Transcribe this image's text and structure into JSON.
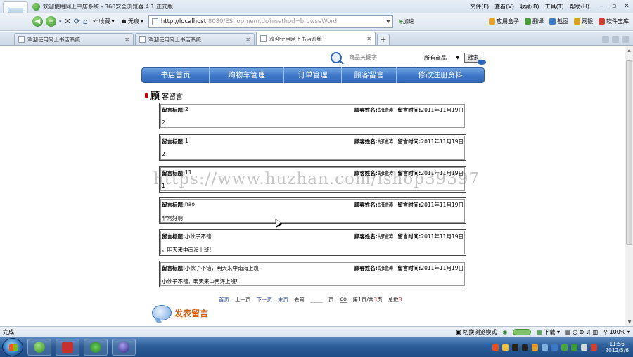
{
  "window": {
    "title": "欢迎使用网上书店系统 - 360安全浏览器 4.1 正式版",
    "menus": [
      "文件(F)",
      "查看(V)",
      "收藏(B)",
      "工具(T)",
      "帮助(H)"
    ],
    "controls": {
      "min": "–",
      "max": "▫",
      "close": "✕"
    }
  },
  "toolbar": {
    "favorites_label": "收藏",
    "no_trace_label": "无痕",
    "url_host": "http://localhost",
    "url_rest": ":8080/EShopmem.do?method=browseWord",
    "accel_label": "加速",
    "right_buttons": [
      "应用盒子",
      "翻译",
      "截图",
      "网银",
      "软件宝库"
    ]
  },
  "tabs": [
    {
      "label": "欢迎使用网上书店系统",
      "active": false
    },
    {
      "label": "欢迎使用网上书店系统",
      "active": false
    },
    {
      "label": "欢迎使用网上书店系统",
      "active": true
    }
  ],
  "new_tab_label": "+",
  "search": {
    "keyword_placeholder": "商品关键字",
    "category": "所有商品",
    "button": "搜索"
  },
  "nav": {
    "items": [
      "书店首页",
      "购物车管理",
      "订单管理",
      "顾客留言",
      "修改注册资料"
    ]
  },
  "section": {
    "title_big": "顾",
    "title_rest": "客留言"
  },
  "messages": [
    {
      "title_label": "留言标题:",
      "title": "2",
      "name_label": "顾客姓名:",
      "name": "胡瑞涛",
      "time_label": "留言时间:",
      "time": "2011年11月19日",
      "body": "2"
    },
    {
      "title_label": "留言标题:",
      "title": "1",
      "name_label": "顾客姓名:",
      "name": "胡瑞涛",
      "time_label": "留言时间:",
      "time": "2011年11月19日",
      "body": "2"
    },
    {
      "title_label": "留言标题:",
      "title": "11",
      "name_label": "顾客姓名:",
      "name": "胡瑞涛",
      "time_label": "留言时间:",
      "time": "2011年11月19日",
      "body": "1"
    },
    {
      "title_label": "留言标题:",
      "title": "hao",
      "name_label": "顾客姓名:",
      "name": "胡瑞涛",
      "time_label": "留言时间:",
      "time": "2011年11月19日",
      "body": "非常好啊"
    },
    {
      "title_label": "留言标题:",
      "title": "小伙子不错",
      "name_label": "顾客姓名:",
      "name": "胡瑞涛",
      "time_label": "留言时间:",
      "time": "2011年11月19日",
      "body": "，明天来中南海上班!"
    },
    {
      "title_label": "留言标题:",
      "title": "小伙子不错，明天来中南海上班!",
      "name_label": "顾客姓名:",
      "name": "胡瑞涛",
      "time_label": "留言时间:",
      "time": "2011年11月19日",
      "body": "小伙子不错，明天来中南海上班!"
    }
  ],
  "pager": {
    "first": "首页",
    "prev": "上一页",
    "next": "下一页",
    "last": "末页",
    "goto_label": "去第",
    "page_unit": "页",
    "go_button": "GO",
    "page_info_prefix": "第1页/共",
    "page_total": "3",
    "page_info_suffix": "页",
    "count_label": "总数",
    "count_value": "8"
  },
  "post_label": "发表留言",
  "watermark": "https://www.huzhan.com/ishop39397",
  "status": {
    "text": "完成",
    "switch_label": "切换浏览模式",
    "download_label": "下载",
    "zoom": "100%"
  },
  "clock": {
    "time": "11:56",
    "date": "2012/5/6"
  }
}
